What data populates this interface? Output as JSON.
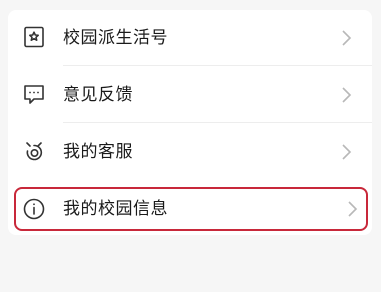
{
  "menu": {
    "items": [
      {
        "label": "校园派生活号",
        "icon": "badge-star-icon"
      },
      {
        "label": "意见反馈",
        "icon": "chat-bubble-icon"
      },
      {
        "label": "我的客服",
        "icon": "service-bot-icon"
      },
      {
        "label": "我的校园信息",
        "icon": "info-circle-icon",
        "highlighted": true
      }
    ],
    "chevron_icon": "chevron-right-icon",
    "highlight_color": "#c8283a"
  }
}
